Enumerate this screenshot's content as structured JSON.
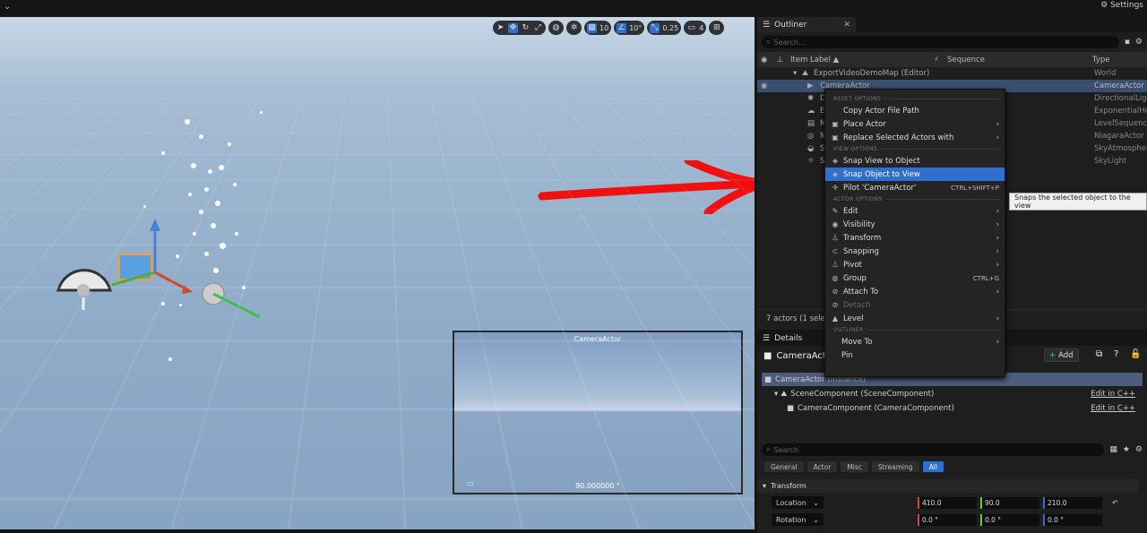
{
  "topbar": {
    "settings": "Settings"
  },
  "viewport": {
    "toolbar": {
      "grid_snap": "10",
      "angle_snap": "10°",
      "scale_snap": "0.25",
      "camera_speed": "4"
    },
    "preview": {
      "title": "CameraActor",
      "fov": "90.000000 °"
    }
  },
  "outliner": {
    "tab": "Outliner",
    "search_placeholder": "Search...",
    "columns": {
      "label": "Item Label ▲",
      "sequence": "Sequence",
      "type": "Type"
    },
    "rows": [
      {
        "label": "ExportVideoDemoMap (Editor)",
        "type": "World"
      },
      {
        "label": "CameraActor",
        "type": "CameraActor"
      },
      {
        "label": "D",
        "type": "DirectionalLigh"
      },
      {
        "label": "E",
        "type": "ExponentialHei"
      },
      {
        "label": "M",
        "type": "LevelSequence"
      },
      {
        "label": "N",
        "type": "NiagaraActor"
      },
      {
        "label": "S",
        "type": "SkyAtmospher"
      },
      {
        "label": "S",
        "type": "SkyLight"
      }
    ],
    "footer": "7 actors (1 selec"
  },
  "context_menu": {
    "sections": {
      "asset": "ASSET OPTIONS",
      "view": "VIEW OPTIONS",
      "actor": "ACTOR OPTIONS",
      "outliner": "OUTLINER"
    },
    "asset_items": [
      "Copy Actor File Path",
      "Place Actor",
      "Replace Selected Actors with"
    ],
    "view_items": [
      "Snap View to Object",
      "Snap Object to View",
      "Pilot 'CameraActor'"
    ],
    "pilot_shortcut": "CTRL+SHIFT+P",
    "actor_items": [
      "Edit",
      "Visibility",
      "Transform",
      "Snapping",
      "Pivot",
      "Group",
      "Attach To",
      "Detach",
      "Level"
    ],
    "group_shortcut": "CTRL+G",
    "outliner_items": [
      "Move To",
      "Pin"
    ]
  },
  "tooltip": "Snaps the selected object to the view",
  "details": {
    "tab": "Details",
    "actor_name": "CameraActo",
    "add_label": "Add",
    "components": [
      "CameraActor (Instance)",
      "SceneComponent (SceneComponent)",
      "CameraComponent (CameraComponent)"
    ],
    "edit_cpp": "Edit in C++",
    "search_placeholder": "Search",
    "filters": [
      "General",
      "Actor",
      "Misc",
      "Streaming",
      "All"
    ],
    "section": "Transform",
    "location": {
      "label": "Location",
      "x": "410.0",
      "y": "90.0",
      "z": "210.0"
    },
    "rotation": {
      "label": "Rotation",
      "x": "0.0 °",
      "y": "0.0 °",
      "z": "0.0 °"
    }
  }
}
